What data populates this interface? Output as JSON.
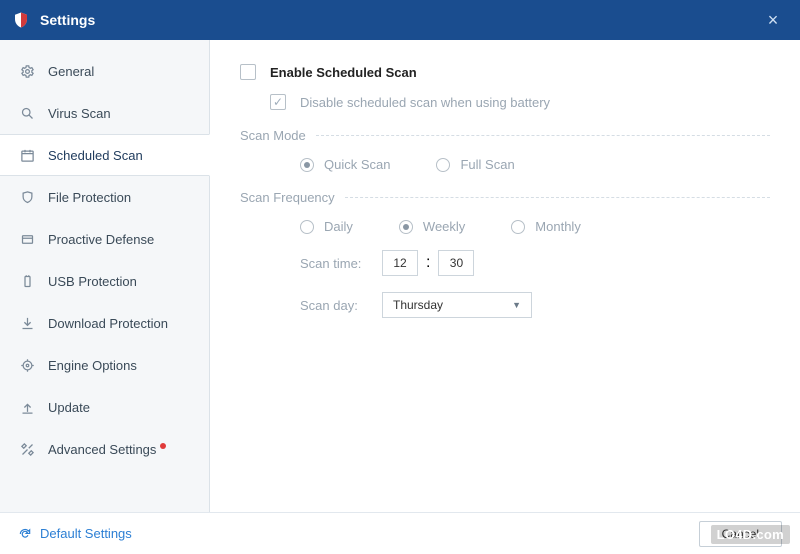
{
  "titlebar": {
    "title": "Settings"
  },
  "sidebar": {
    "items": [
      {
        "label": "General"
      },
      {
        "label": "Virus Scan"
      },
      {
        "label": "Scheduled Scan"
      },
      {
        "label": "File Protection"
      },
      {
        "label": "Proactive Defense"
      },
      {
        "label": "USB Protection"
      },
      {
        "label": "Download Protection"
      },
      {
        "label": "Engine Options"
      },
      {
        "label": "Update"
      },
      {
        "label": "Advanced Settings"
      }
    ]
  },
  "content": {
    "enable_label": "Enable Scheduled Scan",
    "disable_battery_label": "Disable scheduled scan when using battery",
    "scan_mode_label": "Scan Mode",
    "scan_mode_options": {
      "quick": "Quick Scan",
      "full": "Full Scan"
    },
    "scan_frequency_label": "Scan Frequency",
    "scan_frequency_options": {
      "daily": "Daily",
      "weekly": "Weekly",
      "monthly": "Monthly"
    },
    "scan_time_label": "Scan time:",
    "scan_time_hour": "12",
    "scan_time_sep": ":",
    "scan_time_minute": "30",
    "scan_day_label": "Scan day:",
    "scan_day_value": "Thursday"
  },
  "footer": {
    "default_link": "Default Settings",
    "cancel": "Cancel"
  },
  "watermark": "LO4D.com"
}
